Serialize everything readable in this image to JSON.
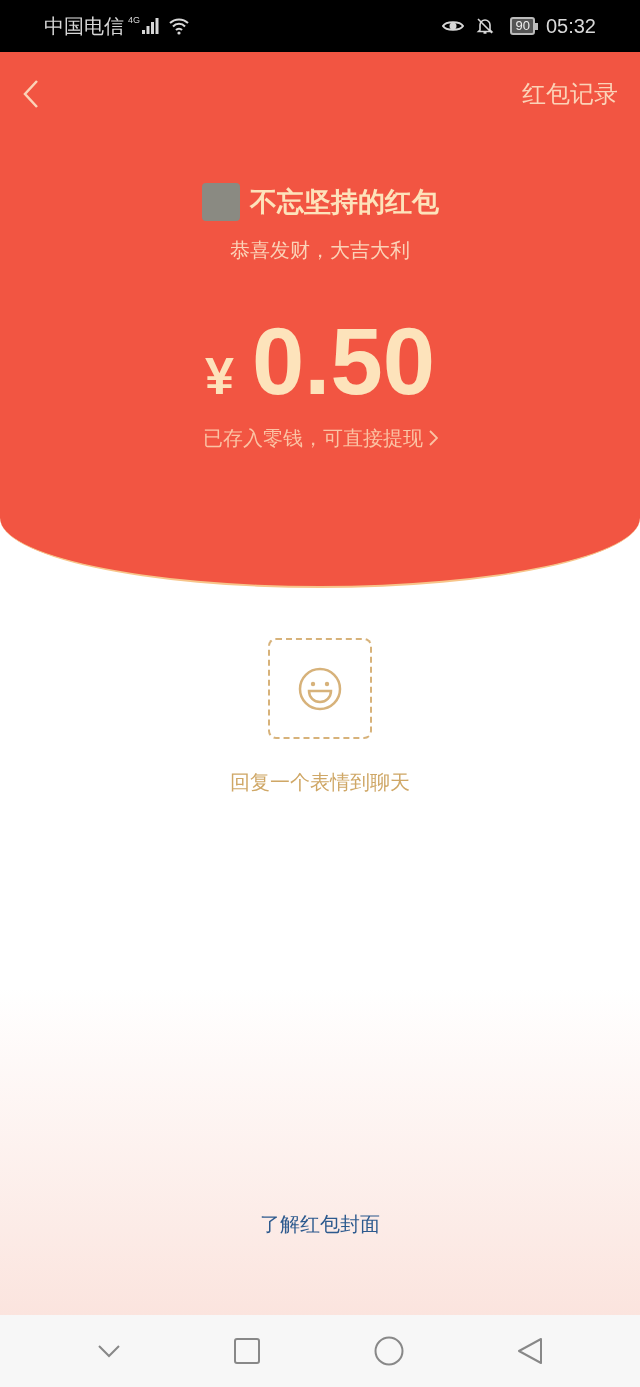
{
  "status_bar": {
    "carrier": "中国电信",
    "network": "4G",
    "battery": "90",
    "time": "05:32"
  },
  "header": {
    "records_link": "红包记录"
  },
  "packet": {
    "sender": "不忘坚持的红包",
    "greeting": "恭喜发财，大吉大利",
    "currency": "¥",
    "amount": "0.50",
    "note": "已存入零钱，可直接提现"
  },
  "reply": {
    "label": "回复一个表情到聊天"
  },
  "cover_link": "了解红包封面"
}
